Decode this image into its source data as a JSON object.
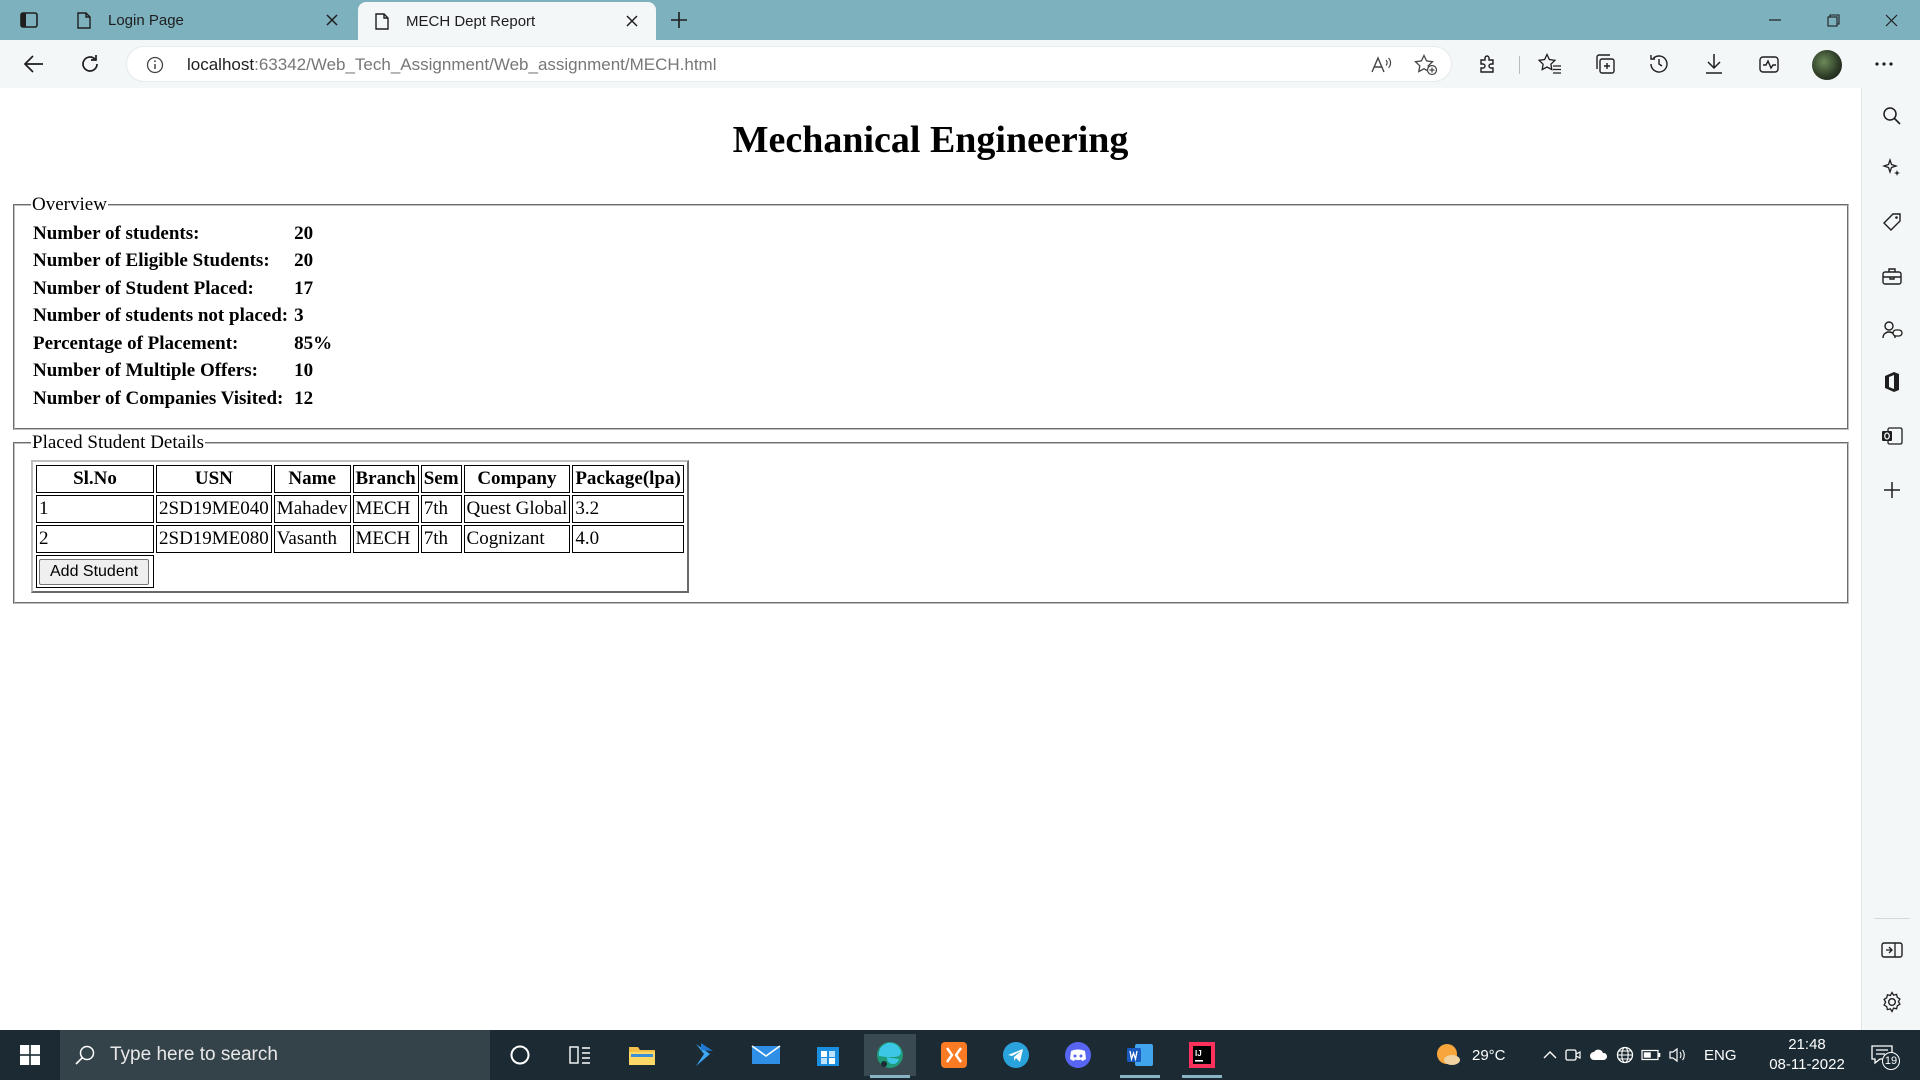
{
  "browser": {
    "tabs": [
      {
        "label": "Login Page",
        "active": false
      },
      {
        "label": "MECH Dept Report",
        "active": true
      }
    ],
    "url": {
      "host": "localhost",
      "rest": ":63342/Web_Tech_Assignment/Web_assignment/MECH.html"
    }
  },
  "page": {
    "title": "Mechanical Engineering",
    "overview": {
      "legend": "Overview",
      "rows": [
        {
          "label": "Number of students:",
          "value": "20"
        },
        {
          "label": "Number of Eligible Students:",
          "value": "20"
        },
        {
          "label": "Number of Student Placed:",
          "value": "17"
        },
        {
          "label": "Number of students not placed:",
          "value": "3"
        },
        {
          "label": "Percentage of Placement:",
          "value": "85%"
        },
        {
          "label": "Number of Multiple Offers:",
          "value": "10"
        },
        {
          "label": "Number of Companies Visited:",
          "value": "12"
        }
      ]
    },
    "placed": {
      "legend": "Placed Student Details",
      "headers": [
        "Sl.No",
        "USN",
        "Name",
        "Branch",
        "Sem",
        "Company",
        "Package(lpa)"
      ],
      "rows": [
        [
          "1",
          "2SD19ME040",
          "Mahadev",
          "MECH",
          "7th",
          "Quest Global",
          "3.2"
        ],
        [
          "2",
          "2SD19ME080",
          "Vasanth",
          "MECH",
          "7th",
          "Cognizant",
          "4.0"
        ]
      ],
      "add_button": "Add Student"
    }
  },
  "taskbar": {
    "search_placeholder": "Type here to search",
    "weather": "29°C",
    "language": "ENG",
    "time": "21:48",
    "date": "08-11-2022",
    "notification_count": "19"
  },
  "colors": {
    "tabstrip": "#7cb1bd",
    "toolbar": "#f3f7f8",
    "taskbar": "#1c2b33"
  }
}
